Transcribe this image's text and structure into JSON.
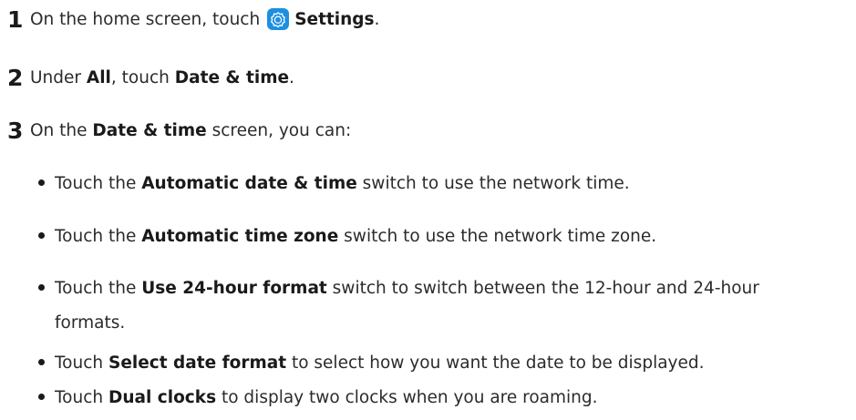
{
  "steps": [
    {
      "number": "1",
      "prefix": "On the home screen, touch",
      "icon": "settings-app-icon",
      "bold": "Settings",
      "suffix": "."
    },
    {
      "number": "2",
      "prefix": "Under",
      "bold1": "All",
      "mid": ", touch",
      "bold2": "Date & time",
      "suffix": "."
    },
    {
      "number": "3",
      "prefix": "On the",
      "bold": "Date & time",
      "suffix": "screen, you can:"
    }
  ],
  "bullets": [
    {
      "prefix": "Touch the",
      "bold": "Automatic date & time",
      "suffix": "switch to use the network time."
    },
    {
      "prefix": "Touch the",
      "bold": "Automatic time zone",
      "suffix": "switch to use the network time zone."
    },
    {
      "prefix": "Touch the",
      "bold": "Use 24-hour format",
      "suffix": "switch to switch between the 12-hour and 24-hour",
      "continuation": "formats."
    },
    {
      "prefix": "Touch",
      "bold": "Select date format",
      "suffix": "to select how you want the date to be displayed."
    },
    {
      "prefix": "Touch",
      "bold": "Dual clocks",
      "suffix": "to display two clocks when you are roaming."
    }
  ],
  "colors": {
    "settings_icon_bg": "#1e8fe0",
    "settings_icon_fg": "#ffffff"
  }
}
